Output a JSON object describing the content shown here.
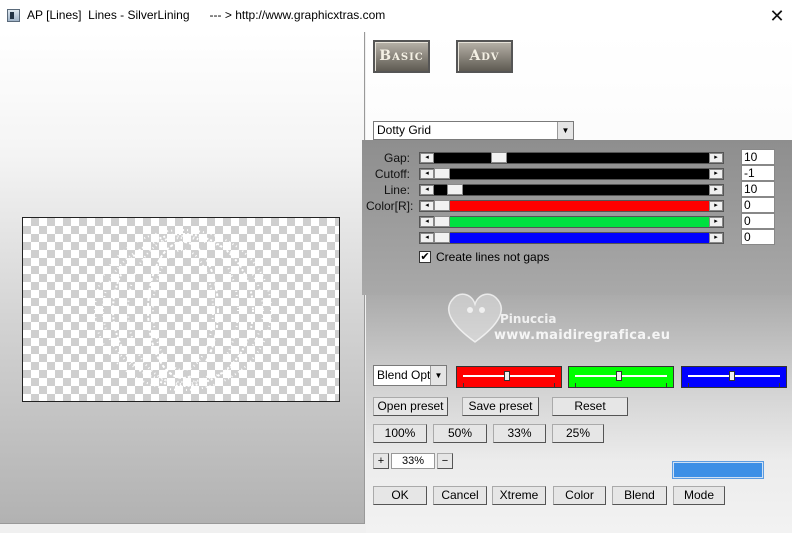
{
  "window": {
    "title": "AP [Lines]  Lines - SilverLining      --- > http://www.graphicxtras.com",
    "close_glyph": "✕"
  },
  "tabs": {
    "basic": "Basic",
    "adv": "Adv"
  },
  "pattern_select": {
    "value": "Dotty Grid"
  },
  "sliders": [
    {
      "label": "Gap:",
      "value": "10",
      "level": 0.22,
      "fill": "#000000"
    },
    {
      "label": "Cutoff:",
      "value": "-1",
      "level": 0.0,
      "fill": "#000000"
    },
    {
      "label": "Line:",
      "value": "10",
      "level": 0.05,
      "fill": "#000000"
    },
    {
      "label": "Color[R]:",
      "value": "0",
      "level": 0.0,
      "fill": "#ff0000"
    },
    {
      "label": "",
      "value": "0",
      "level": 0.0,
      "fill": "#00e040"
    },
    {
      "label": "",
      "value": "0",
      "level": 0.0,
      "fill": "#0000ff"
    }
  ],
  "checkbox": {
    "label": "Create lines not gaps",
    "checked": true
  },
  "watermark": {
    "line1": "Pinuccia",
    "line2": "www.maidiregrafica.eu"
  },
  "blend": {
    "select_value": "Blend Opti",
    "colors": [
      "#ff0000",
      "#00ff00",
      "#0000ff"
    ],
    "levels": [
      0.5,
      0.5,
      0.5
    ]
  },
  "buttons": {
    "open_preset": "Open preset",
    "save_preset": "Save preset",
    "reset": "Reset",
    "z100": "100%",
    "z50": "50%",
    "z33": "33%",
    "z25": "25%",
    "ok": "OK",
    "cancel": "Cancel",
    "xtreme": "Xtreme",
    "color": "Color",
    "blend": "Blend",
    "mode": "Mode"
  },
  "zoom": {
    "plus": "+",
    "value": "33%",
    "minus": "−"
  },
  "accent_color": "#3c8fe6"
}
